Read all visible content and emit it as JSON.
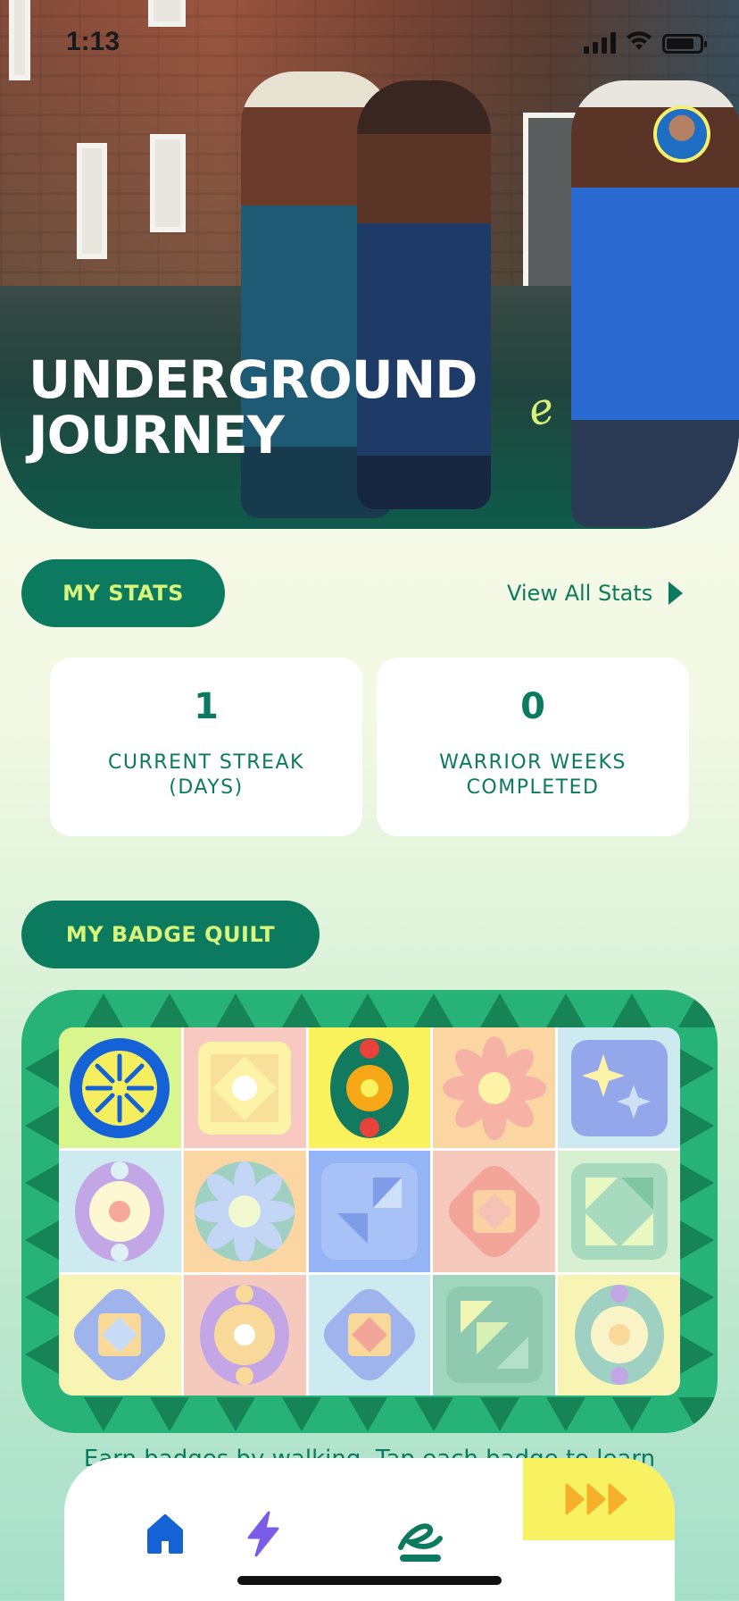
{
  "status_bar": {
    "time": "1:13"
  },
  "hero": {
    "title_line1": "UNDERGROUND",
    "title_line2": "JOURNEY",
    "avatar_icon": "profile-avatar"
  },
  "stats": {
    "section_label": "MY STATS",
    "view_all_label": "View All Stats",
    "cards": [
      {
        "value": "1",
        "label": "CURRENT STREAK\n(DAYS)"
      },
      {
        "value": "0",
        "label": "WARRIOR WEEKS\nCOMPLETED"
      }
    ]
  },
  "badges": {
    "section_label": "MY BADGE QUILT",
    "caption": "Earn badges by walking. Tap each badge to learn",
    "tiles": [
      "sun-badge",
      "diamond-square-badge",
      "oval-dot-badge",
      "flower-badge",
      "sparkle-badge",
      "oval-ring-badge",
      "daisy-badge",
      "steps-badge",
      "rhombus-badge",
      "pinwheel-badge",
      "rhombus-square-badge",
      "oval-ring-badge-2",
      "rhombus-badge-2",
      "triangles-badge",
      "oval-ring-badge-3"
    ]
  },
  "tabs": {
    "items": [
      {
        "name": "home-icon"
      },
      {
        "name": "lightning-icon"
      },
      {
        "name": "walk-logo-icon"
      },
      {
        "name": "fast-forward-icon"
      }
    ],
    "active_index": 2
  },
  "colors": {
    "brand_green": "#0c7a5f",
    "accent_lime": "#d8f57c",
    "quilt_green": "#27b377",
    "highlight_yellow": "#f8f262"
  }
}
